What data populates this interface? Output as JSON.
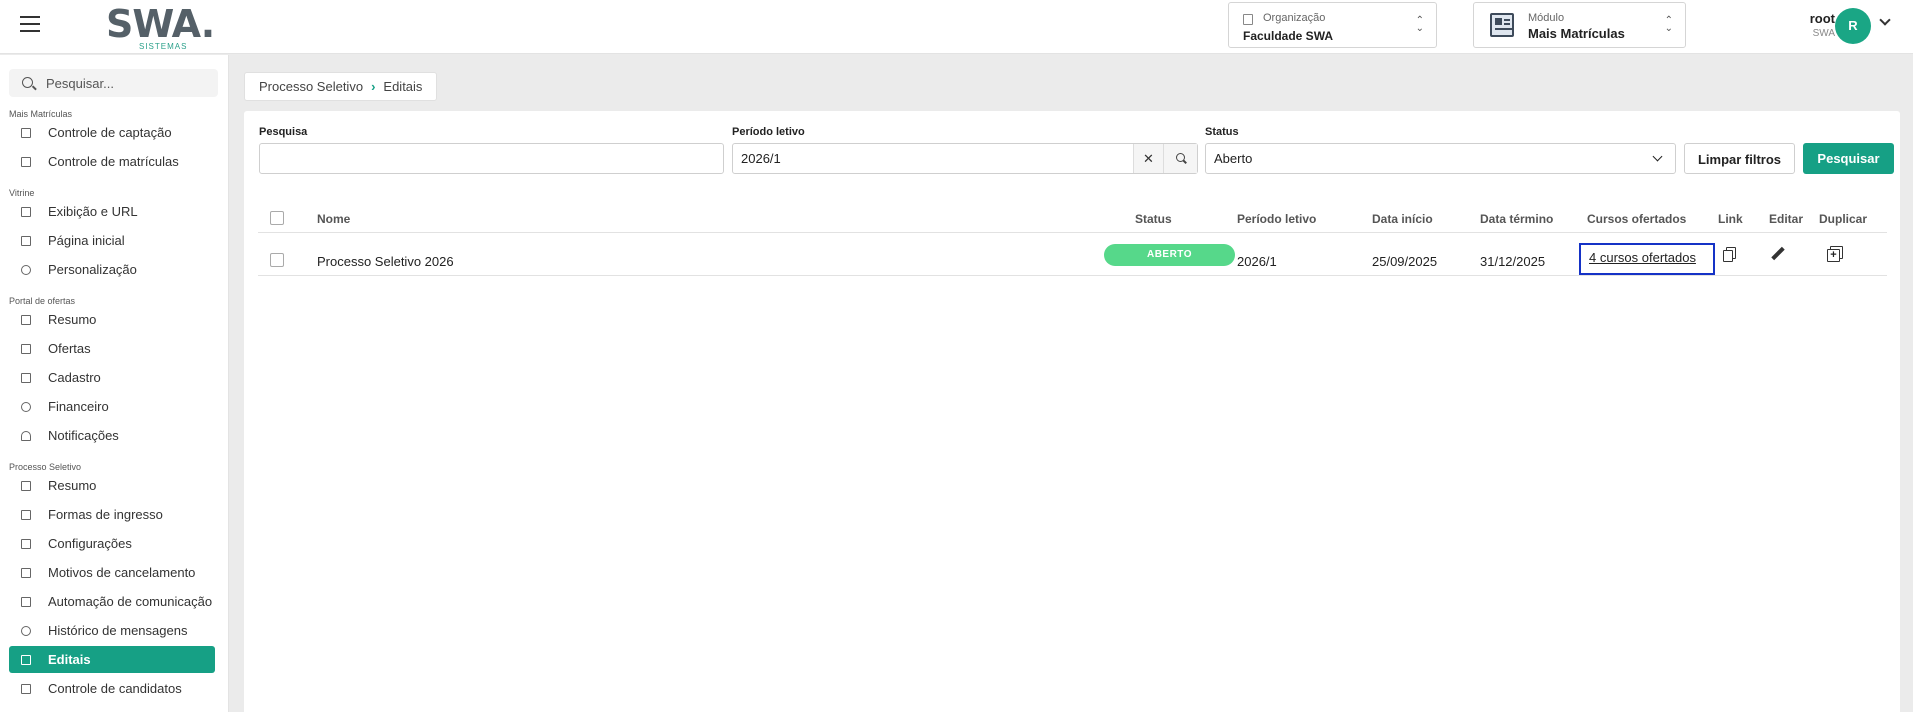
{
  "topbar": {
    "logo_text": "SWA",
    "logo_dot": ".",
    "logo_sub": "SISTEMAS",
    "organization": {
      "label": "Organização",
      "value": "Faculdade SWA"
    },
    "module": {
      "label": "Módulo",
      "value": "Mais Matrículas"
    },
    "user": {
      "name": "root",
      "org": "SWA",
      "initial": "R"
    }
  },
  "sidebar": {
    "search_placeholder": "Pesquisar...",
    "sections": [
      {
        "title": "Mais Matrículas",
        "items": [
          {
            "label": "Controle de captação",
            "icon": "person-plus-icon"
          },
          {
            "label": "Controle de matrículas",
            "icon": "document-icon"
          }
        ]
      },
      {
        "title": "Vitrine",
        "items": [
          {
            "label": "Exibição e URL",
            "icon": "browser-icon"
          },
          {
            "label": "Página inicial",
            "icon": "grid-icon"
          },
          {
            "label": "Personalização",
            "icon": "palette-icon"
          }
        ]
      },
      {
        "title": "Portal de ofertas",
        "items": [
          {
            "label": "Resumo",
            "icon": "summary-icon"
          },
          {
            "label": "Ofertas",
            "icon": "cart-icon"
          },
          {
            "label": "Cadastro",
            "icon": "user-edit-icon"
          },
          {
            "label": "Financeiro",
            "icon": "money-icon"
          },
          {
            "label": "Notificações",
            "icon": "bell-icon"
          }
        ]
      },
      {
        "title": "Processo Seletivo",
        "items": [
          {
            "label": "Resumo",
            "icon": "summary-icon"
          },
          {
            "label": "Formas de ingresso",
            "icon": "id-card-icon"
          },
          {
            "label": "Configurações",
            "icon": "graduation-icon"
          },
          {
            "label": "Motivos de cancelamento",
            "icon": "list-icon"
          },
          {
            "label": "Automação de comunicação",
            "icon": "mail-icon"
          },
          {
            "label": "Histórico de mensagens",
            "icon": "chat-icon"
          },
          {
            "label": "Editais",
            "icon": "calendar-icon",
            "active": true
          },
          {
            "label": "Controle de candidatos",
            "icon": "document-icon"
          }
        ]
      }
    ]
  },
  "breadcrumb": {
    "parent": "Processo Seletivo",
    "current": "Editais"
  },
  "filters": {
    "search": {
      "label": "Pesquisa",
      "value": ""
    },
    "period": {
      "label": "Período letivo",
      "value": "2026/1",
      "clear": "✕"
    },
    "status": {
      "label": "Status",
      "value": "Aberto"
    },
    "clear_button": "Limpar filtros",
    "search_button": "Pesquisar"
  },
  "table": {
    "columns": [
      "Nome",
      "Status",
      "Período letivo",
      "Data início",
      "Data término",
      "Cursos ofertados",
      "Link",
      "Editar",
      "Duplicar"
    ],
    "rows": [
      {
        "name": "Processo Seletivo 2026",
        "status": "ABERTO",
        "period": "2026/1",
        "start": "25/09/2025",
        "end": "31/12/2025",
        "courses": "4 cursos ofertados"
      }
    ]
  },
  "colors": {
    "accent": "#16a085",
    "badge": "#56d88a",
    "focus": "#1532c6"
  }
}
